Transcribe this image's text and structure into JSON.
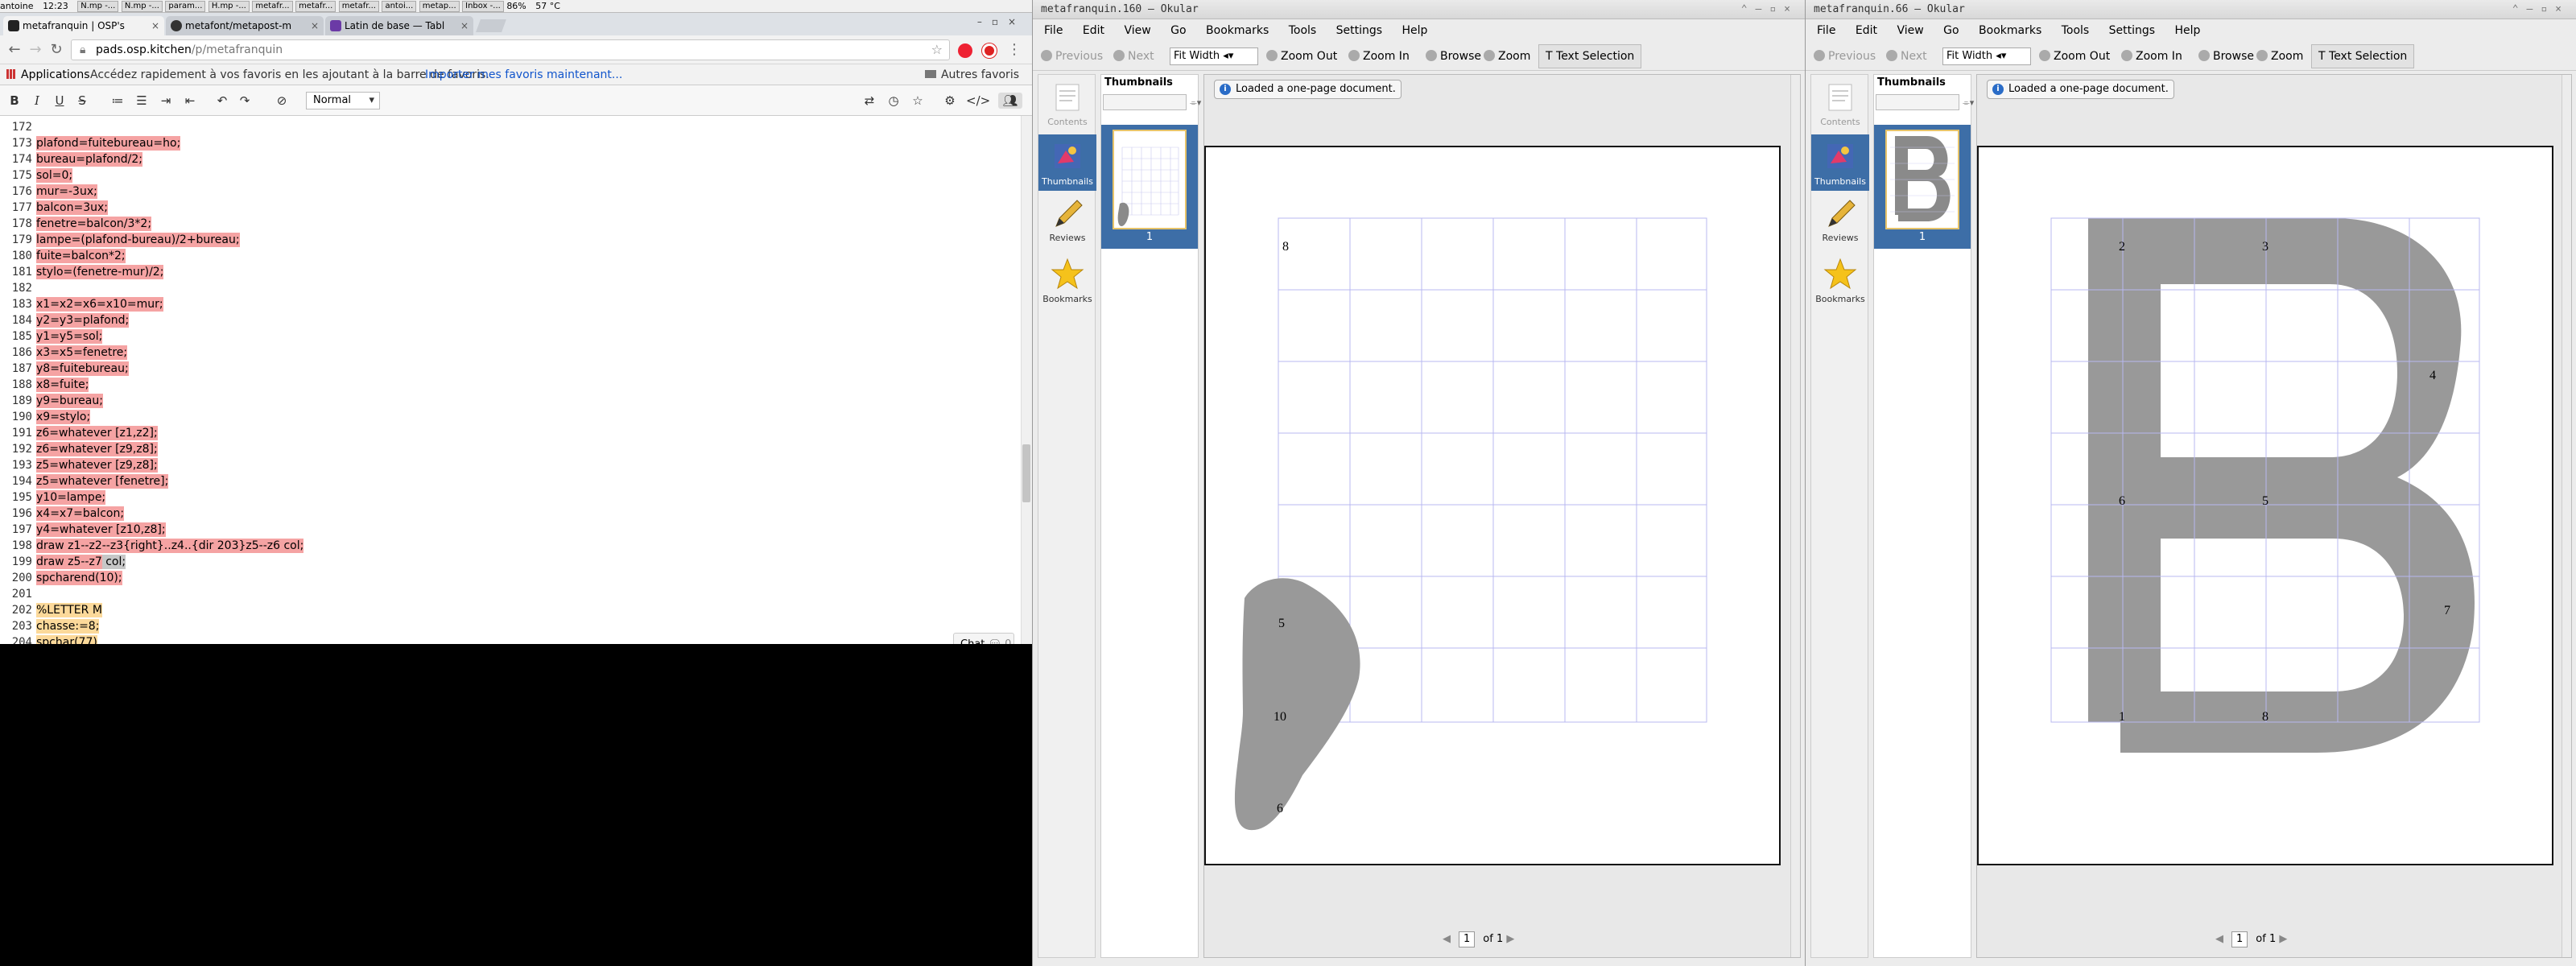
{
  "taskbar": {
    "user": "antoine",
    "clock": "12:23",
    "items": [
      "N.mp -...",
      "N.mp -...",
      "param...",
      "H.mp -...",
      "metafr...",
      "metafr...",
      "metafr...",
      "antoi...",
      "metap...",
      "Inbox -..."
    ],
    "battery": "86%",
    "temp": "57 °C"
  },
  "browser": {
    "tabs": [
      {
        "label": "metafranquin | OSP's",
        "active": true
      },
      {
        "label": "metafont/metapost-m",
        "active": false
      },
      {
        "label": "Latin de base — Tabl",
        "active": false
      }
    ],
    "url_host": "pads.osp.kitchen",
    "url_path": "/p/metafranquin",
    "bookmarks": {
      "apps": "Applications",
      "hint": "Accédez rapidement à vos favoris en les ajoutant à la barre de favoris.",
      "import": "Importer mes favoris maintenant...",
      "other": "Autres favoris"
    }
  },
  "pad": {
    "style_select": "Normal",
    "chat_label": "Chat",
    "chat_count": "0",
    "lines": [
      {
        "n": "172",
        "parts": []
      },
      {
        "n": "173",
        "parts": [
          {
            "t": "plafond=fuitebureau=ho;",
            "h": "r"
          }
        ]
      },
      {
        "n": "174",
        "parts": [
          {
            "t": "bureau=plafond/2;",
            "h": "r"
          }
        ]
      },
      {
        "n": "175",
        "parts": [
          {
            "t": "sol=0;",
            "h": "r"
          }
        ]
      },
      {
        "n": "176",
        "parts": [
          {
            "t": "mur=-3ux;",
            "h": "r"
          }
        ]
      },
      {
        "n": "177",
        "parts": [
          {
            "t": "balcon=3ux;",
            "h": "r"
          }
        ]
      },
      {
        "n": "178",
        "parts": [
          {
            "t": "fenetre=balcon/3*2;",
            "h": "r"
          }
        ]
      },
      {
        "n": "179",
        "parts": [
          {
            "t": "lampe=(plafond-bureau)/2+bureau;",
            "h": "r"
          }
        ]
      },
      {
        "n": "180",
        "parts": [
          {
            "t": "fuite=balcon*2;",
            "h": "r"
          }
        ]
      },
      {
        "n": "181",
        "parts": [
          {
            "t": "stylo=(fenetre-mur)/2;",
            "h": "r"
          }
        ]
      },
      {
        "n": "182",
        "parts": []
      },
      {
        "n": "183",
        "parts": [
          {
            "t": "x1=x2=x6=x10=mur;",
            "h": "r"
          }
        ]
      },
      {
        "n": "184",
        "parts": [
          {
            "t": "y2=y3=plafond;",
            "h": "r"
          }
        ]
      },
      {
        "n": "185",
        "parts": [
          {
            "t": "y1=y5=sol;",
            "h": "r"
          }
        ]
      },
      {
        "n": "186",
        "parts": [
          {
            "t": "x3=x5=fenetre;",
            "h": "r"
          }
        ]
      },
      {
        "n": "187",
        "parts": [
          {
            "t": "y8=fuitebureau;",
            "h": "r"
          }
        ]
      },
      {
        "n": "188",
        "parts": [
          {
            "t": "x8=fuite;",
            "h": "r"
          }
        ]
      },
      {
        "n": "189",
        "parts": [
          {
            "t": "y9=bureau;",
            "h": "r"
          }
        ]
      },
      {
        "n": "190",
        "parts": [
          {
            "t": "x9=stylo;",
            "h": "r"
          }
        ]
      },
      {
        "n": "191",
        "parts": [
          {
            "t": "z6=whatever [z1,z2];",
            "h": "r"
          }
        ]
      },
      {
        "n": "192",
        "parts": [
          {
            "t": "z6=whatever [z9,z8];",
            "h": "r"
          }
        ]
      },
      {
        "n": "193",
        "parts": [
          {
            "t": "z5=whatever [z9,z8];",
            "h": "r"
          }
        ]
      },
      {
        "n": "194",
        "parts": [
          {
            "t": "z5=whatever [fenetre];",
            "h": "r"
          }
        ]
      },
      {
        "n": "195",
        "parts": [
          {
            "t": "y10=lampe;",
            "h": "r"
          }
        ]
      },
      {
        "n": "196",
        "parts": [
          {
            "t": "x4=x7=balcon;",
            "h": "r"
          }
        ]
      },
      {
        "n": "197",
        "parts": [
          {
            "t": "y4=whatever [z10,z8];",
            "h": "r"
          }
        ]
      },
      {
        "n": "198",
        "parts": [
          {
            "t": "draw z1--z2--z3{right}..z4..{dir 203}z5--z6 col;",
            "h": "r"
          }
        ]
      },
      {
        "n": "199",
        "parts": [
          {
            "t": "draw z5--z7",
            "h": "r"
          },
          {
            "t": " col;",
            "h": "s"
          }
        ]
      },
      {
        "n": "200",
        "parts": [
          {
            "t": "spcharend(10);",
            "h": "r"
          }
        ]
      },
      {
        "n": "201",
        "parts": []
      },
      {
        "n": "202",
        "parts": [
          {
            "t": "%LETTER M",
            "h": "y"
          }
        ]
      },
      {
        "n": "203",
        "parts": [
          {
            "t": "chasse:=8;",
            "h": "y"
          }
        ]
      },
      {
        "n": "204",
        "parts": [
          {
            "t": "spchar(77)",
            "h": "y"
          }
        ]
      }
    ]
  },
  "okular_common": {
    "menu": [
      "File",
      "Edit",
      "View",
      "Go",
      "Bookmarks",
      "Tools",
      "Settings",
      "Help"
    ],
    "toolbar": {
      "previous": "Previous",
      "next": "Next",
      "fit": "Fit Width",
      "zoom_out": "Zoom Out",
      "zoom_in": "Zoom In",
      "browse": "Browse",
      "zoom": "Zoom",
      "text_selection": "Text Selection"
    },
    "sidebar": {
      "contents": "Contents",
      "thumbnails": "Thumbnails",
      "reviews": "Reviews",
      "bookmarks": "Bookmarks"
    },
    "thumbs_header": "Thumbnails",
    "thumb_page": "1",
    "notice": "Loaded a one-page document.",
    "page_of": "of",
    "page_current": "1",
    "page_total": "1"
  },
  "okular_left": {
    "title": "metafranquin.160 — Okular",
    "point_labels": [
      "8",
      "5",
      "10",
      "6"
    ]
  },
  "okular_right": {
    "title": "metafranquin.66 — Okular",
    "point_labels": [
      "2",
      "3",
      "4",
      "6",
      "5",
      "7",
      "1",
      "8"
    ]
  },
  "colors": {
    "highlight_red": "#f5a3a3",
    "highlight_yellow": "#fcd99a",
    "selection_blue": "#3d6ea7",
    "glyph_gray": "#999999",
    "grid_blue": "#b8b8f0"
  }
}
